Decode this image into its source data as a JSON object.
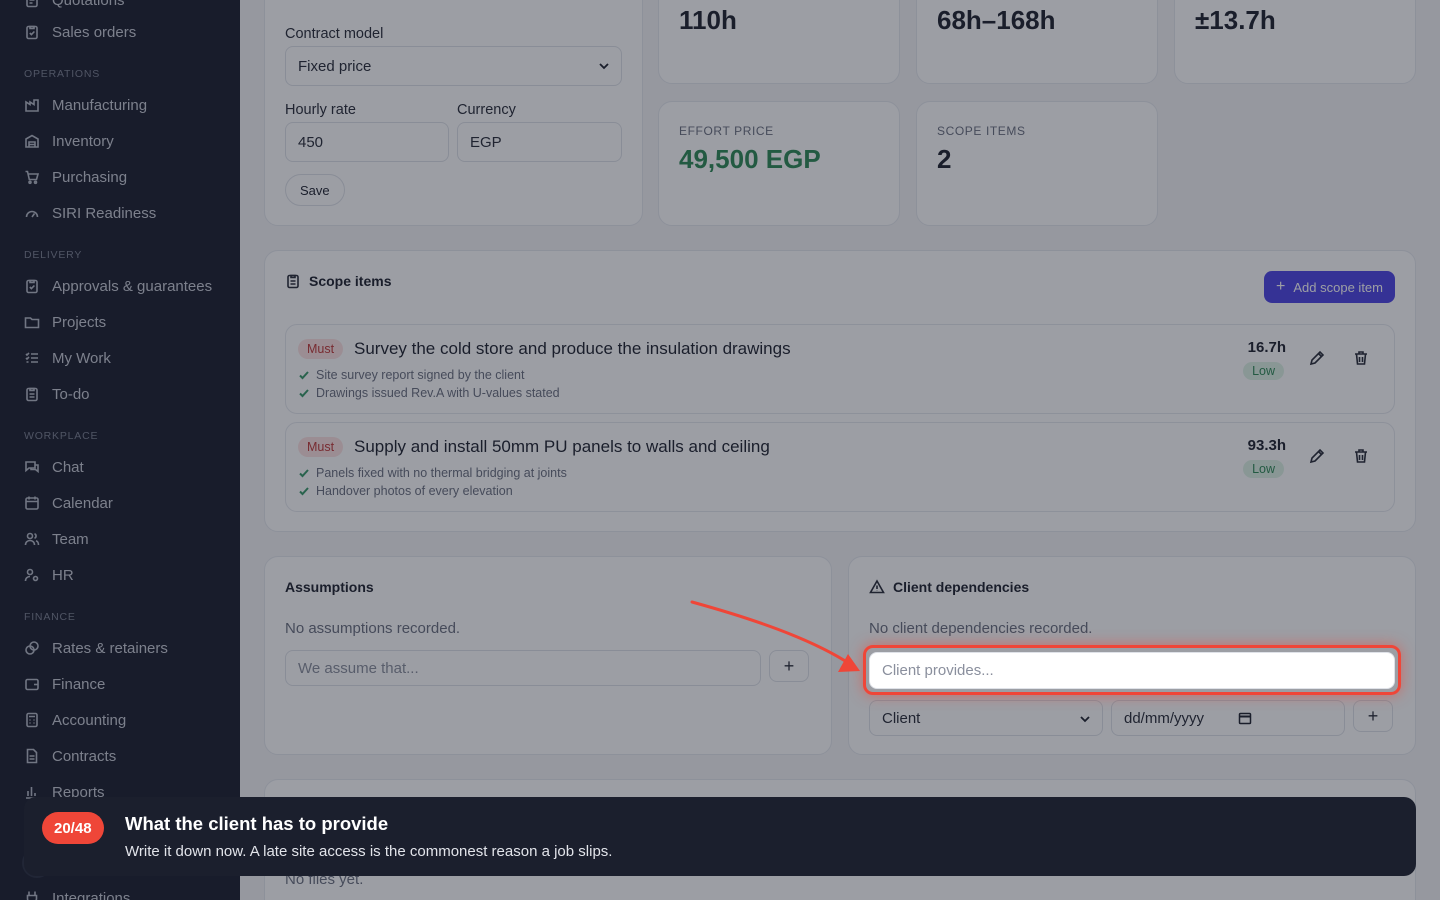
{
  "sidebar": {
    "top_items": [
      {
        "label": "Quotations",
        "icon": "document-icon"
      },
      {
        "label": "Sales orders",
        "icon": "clipboard-check-icon"
      }
    ],
    "sections": [
      {
        "title": "OPERATIONS",
        "items": [
          {
            "label": "Manufacturing",
            "icon": "factory-icon"
          },
          {
            "label": "Inventory",
            "icon": "warehouse-icon"
          },
          {
            "label": "Purchasing",
            "icon": "cart-icon"
          },
          {
            "label": "SIRI Readiness",
            "icon": "gauge-icon"
          }
        ]
      },
      {
        "title": "DELIVERY",
        "items": [
          {
            "label": "Approvals & guarantees",
            "icon": "clipboard-check-icon"
          },
          {
            "label": "Projects",
            "icon": "folder-icon"
          },
          {
            "label": "My Work",
            "icon": "list-check-icon"
          },
          {
            "label": "To-do",
            "icon": "clipboard-icon"
          }
        ]
      },
      {
        "title": "WORKPLACE",
        "items": [
          {
            "label": "Chat",
            "icon": "chat-icon"
          },
          {
            "label": "Calendar",
            "icon": "calendar-icon"
          },
          {
            "label": "Team",
            "icon": "users-icon"
          },
          {
            "label": "HR",
            "icon": "user-cog-icon"
          }
        ]
      },
      {
        "title": "FINANCE",
        "items": [
          {
            "label": "Rates & retainers",
            "icon": "coins-icon"
          },
          {
            "label": "Finance",
            "icon": "wallet-icon"
          },
          {
            "label": "Accounting",
            "icon": "calculator-icon"
          },
          {
            "label": "Contracts",
            "icon": "file-text-icon"
          },
          {
            "label": "Reports",
            "icon": "bar-chart-icon"
          }
        ]
      }
    ],
    "bottom_item": {
      "label": "Integrations",
      "icon": "plug-icon"
    }
  },
  "pricing": {
    "contract_model_label": "Contract model",
    "contract_model_value": "Fixed price",
    "hourly_rate_label": "Hourly rate",
    "hourly_rate_value": "450",
    "currency_label": "Currency",
    "currency_value": "EGP",
    "save_label": "Save"
  },
  "stats": {
    "total_hours": "110h",
    "range": "68h–168h",
    "variance": "±13.7h",
    "effort_price_label": "EFFORT PRICE",
    "effort_price_value": "49,500 EGP",
    "scope_items_label": "SCOPE ITEMS",
    "scope_items_value": "2"
  },
  "scope": {
    "title": "Scope items",
    "add_label": "Add scope item",
    "items": [
      {
        "priority": "Must",
        "title": "Survey the cold store and produce the insulation drawings",
        "criteria": [
          "Site survey report signed by the client",
          "Drawings issued Rev.A with U-values stated"
        ],
        "hours": "16.7h",
        "risk": "Low"
      },
      {
        "priority": "Must",
        "title": "Supply and install 50mm PU panels to walls and ceiling",
        "criteria": [
          "Panels fixed with no thermal bridging at joints",
          "Handover photos of every elevation"
        ],
        "hours": "93.3h",
        "risk": "Low"
      }
    ]
  },
  "assumptions": {
    "title": "Assumptions",
    "empty": "No assumptions recorded.",
    "placeholder": "We assume that...",
    "add": "+"
  },
  "dependencies": {
    "title": "Client dependencies",
    "empty": "No client dependencies recorded.",
    "placeholder": "Client provides...",
    "owner_value": "Client",
    "date_placeholder": "dd/mm/yyyy",
    "add": "+"
  },
  "files": {
    "empty": "No files yet."
  },
  "tour": {
    "step": "20/48",
    "title": "What the client has to provide",
    "text": "Write it down now. A late site access is the commonest reason a job slips."
  },
  "colors": {
    "accent": "#4f46e5",
    "price": "#2f8a57",
    "highlight": "#ef4638"
  }
}
